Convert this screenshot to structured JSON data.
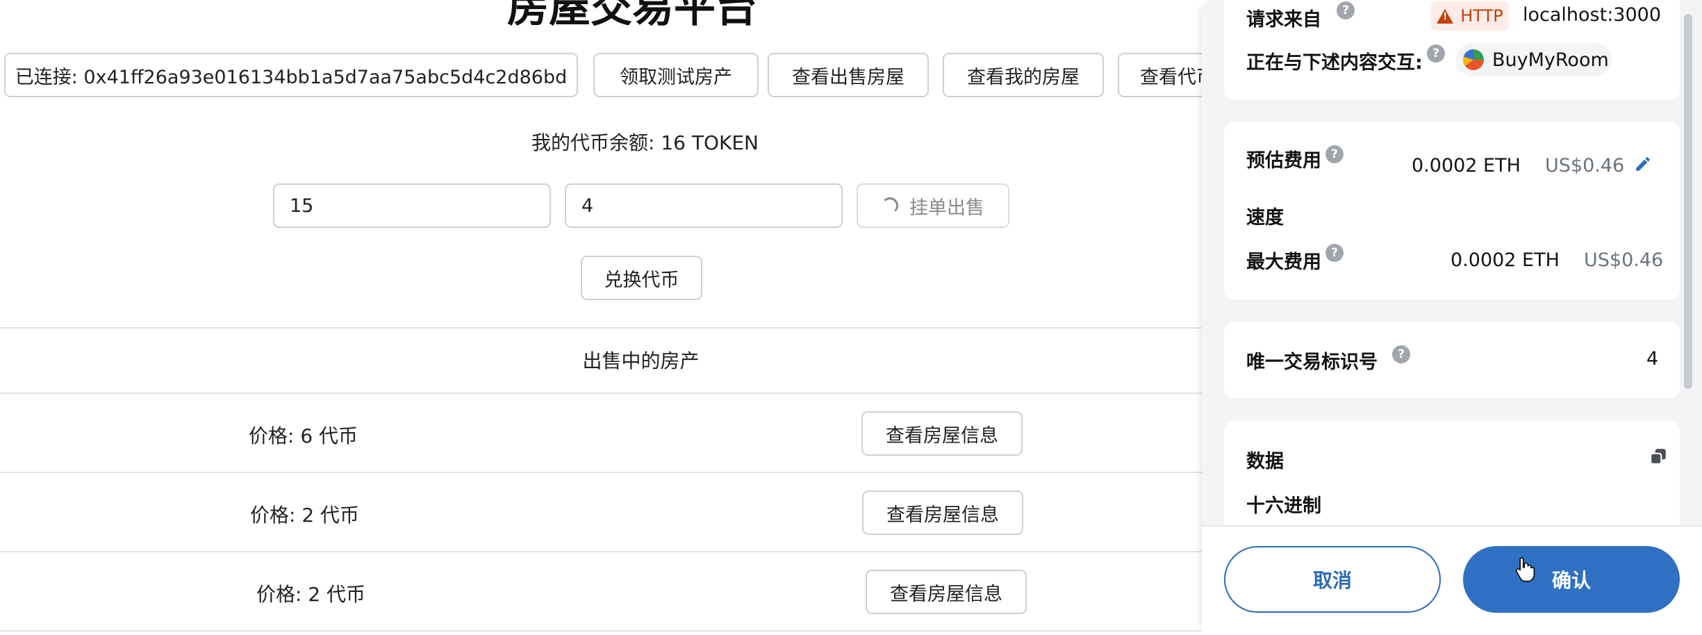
{
  "dapp": {
    "title": "房屋交易平台",
    "connected_label": "已连接: 0x41ff26a93e016134bb1a5d7aa75abc5d4c2d86bd",
    "claim_button": "领取测试房产",
    "view_for_sale_button": "查看出售房屋",
    "view_my_houses_button": "查看我的房屋",
    "view_tokens_button": "查看代币",
    "balance_text": "我的代币余额: 16 TOKEN",
    "inputs": {
      "house_id_value": "15",
      "price_value": "4"
    },
    "list_for_sale_button": "挂单出售",
    "exchange_button": "兑换代币",
    "listings_header": "出售中的房产",
    "listings": [
      {
        "price": "价格: 6 代币",
        "button": "查看房屋信息"
      },
      {
        "price": "价格: 2 代币",
        "button": "查看房屋信息"
      },
      {
        "price": "价格: 2 代币",
        "button": "查看房屋信息"
      }
    ]
  },
  "wallet": {
    "request_from_label": "请求来自",
    "http_badge": "HTTP",
    "origin": "localhost:3000",
    "interacting_label": "正在与下述内容交互:",
    "dapp_name": "BuyMyRoom",
    "estimated_fee_label": "预估费用",
    "estimated_fee_eth": "0.0002 ETH",
    "estimated_fee_usd": "US$0.46",
    "speed_label": "速度",
    "max_fee_label": "最大费用",
    "max_fee_eth": "0.0002 ETH",
    "max_fee_usd": "US$0.46",
    "nonce_label": "唯一交易标识号",
    "nonce_value": "4",
    "data_label": "数据",
    "hex_label": "十六进制",
    "cancel_button": "取消",
    "confirm_button": "确认",
    "help_glyph": "?",
    "colors": {
      "accent": "#2f70c2",
      "warning": "#c2410c"
    }
  }
}
